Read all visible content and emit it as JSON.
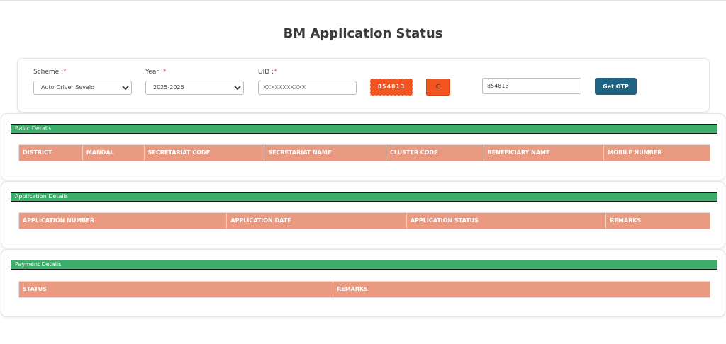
{
  "page": {
    "title": "BM Application Status"
  },
  "form": {
    "scheme": {
      "label": "Scheme :",
      "required_mark": "*",
      "value": "Auto Driver Sevalo",
      "options": [
        "Auto Driver Sevalo"
      ]
    },
    "year": {
      "label": "Year :",
      "required_mark": "*",
      "value": "2025-2026",
      "options": [
        "2025-2026"
      ]
    },
    "uid": {
      "label": "UID :",
      "required_mark": "*",
      "placeholder": "XXXXXXXXXXX"
    },
    "captcha": {
      "text": "854813",
      "refresh_label": "C",
      "input_value": "854813"
    },
    "get_otp_label": "Get OTP"
  },
  "sections": {
    "basic": {
      "title": "Basic Details",
      "columns": [
        "DISTRICT",
        "MANDAL",
        "SECRETARIAT CODE",
        "SECRETARIAT NAME",
        "CLUSTER CODE",
        "BENEFICIARY NAME",
        "MOBILE NUMBER"
      ]
    },
    "application": {
      "title": "Application Details",
      "columns": [
        "APPLICATION NUMBER",
        "APPLICATION DATE",
        "APPLICATION STATUS",
        "REMARKS"
      ]
    },
    "payment": {
      "title": "Payment Details",
      "columns": [
        "STATUS",
        "REMARKS"
      ]
    }
  },
  "colors": {
    "section_header": "#3cad6a",
    "table_header": "#e99a80",
    "captcha": "#f2551f",
    "otp_button": "#1e6482"
  },
  "icons": {
    "refresh": "refresh-icon",
    "dropdown": "chevron-down-icon"
  }
}
